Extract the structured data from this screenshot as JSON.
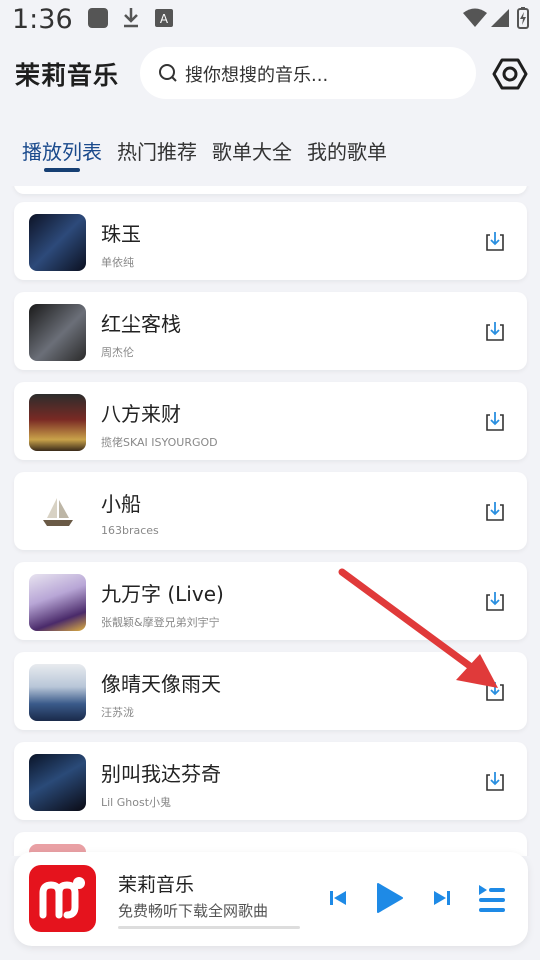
{
  "status_bar": {
    "time": "1:36"
  },
  "header": {
    "app_title": "茉莉音乐",
    "search_placeholder": "搜你想搜的音乐..."
  },
  "tabs": [
    {
      "label": "播放列表"
    },
    {
      "label": "热门推荐"
    },
    {
      "label": "歌单大全"
    },
    {
      "label": "我的歌单"
    }
  ],
  "songs": [
    {
      "title": "珠玉",
      "artist": "单依纯"
    },
    {
      "title": "红尘客栈",
      "artist": "周杰伦"
    },
    {
      "title": "八方来财",
      "artist": "揽佬SKAI ISYOURGOD"
    },
    {
      "title": "小船",
      "artist": "163braces"
    },
    {
      "title": "九万字 (Live)",
      "artist": "张靓颖&摩登兄弟刘宇宁"
    },
    {
      "title": "像晴天像雨天",
      "artist": "汪苏泷"
    },
    {
      "title": "别叫我达芬奇",
      "artist": "Lil Ghost小鬼"
    }
  ],
  "player": {
    "title": "茉莉音乐",
    "subtitle": "免费畅听下载全网歌曲"
  },
  "colors": {
    "accent": "#1a4a8c",
    "control_blue": "#1e8ae6",
    "arrow_red": "#e03a3a",
    "logo_red": "#e5131d"
  }
}
